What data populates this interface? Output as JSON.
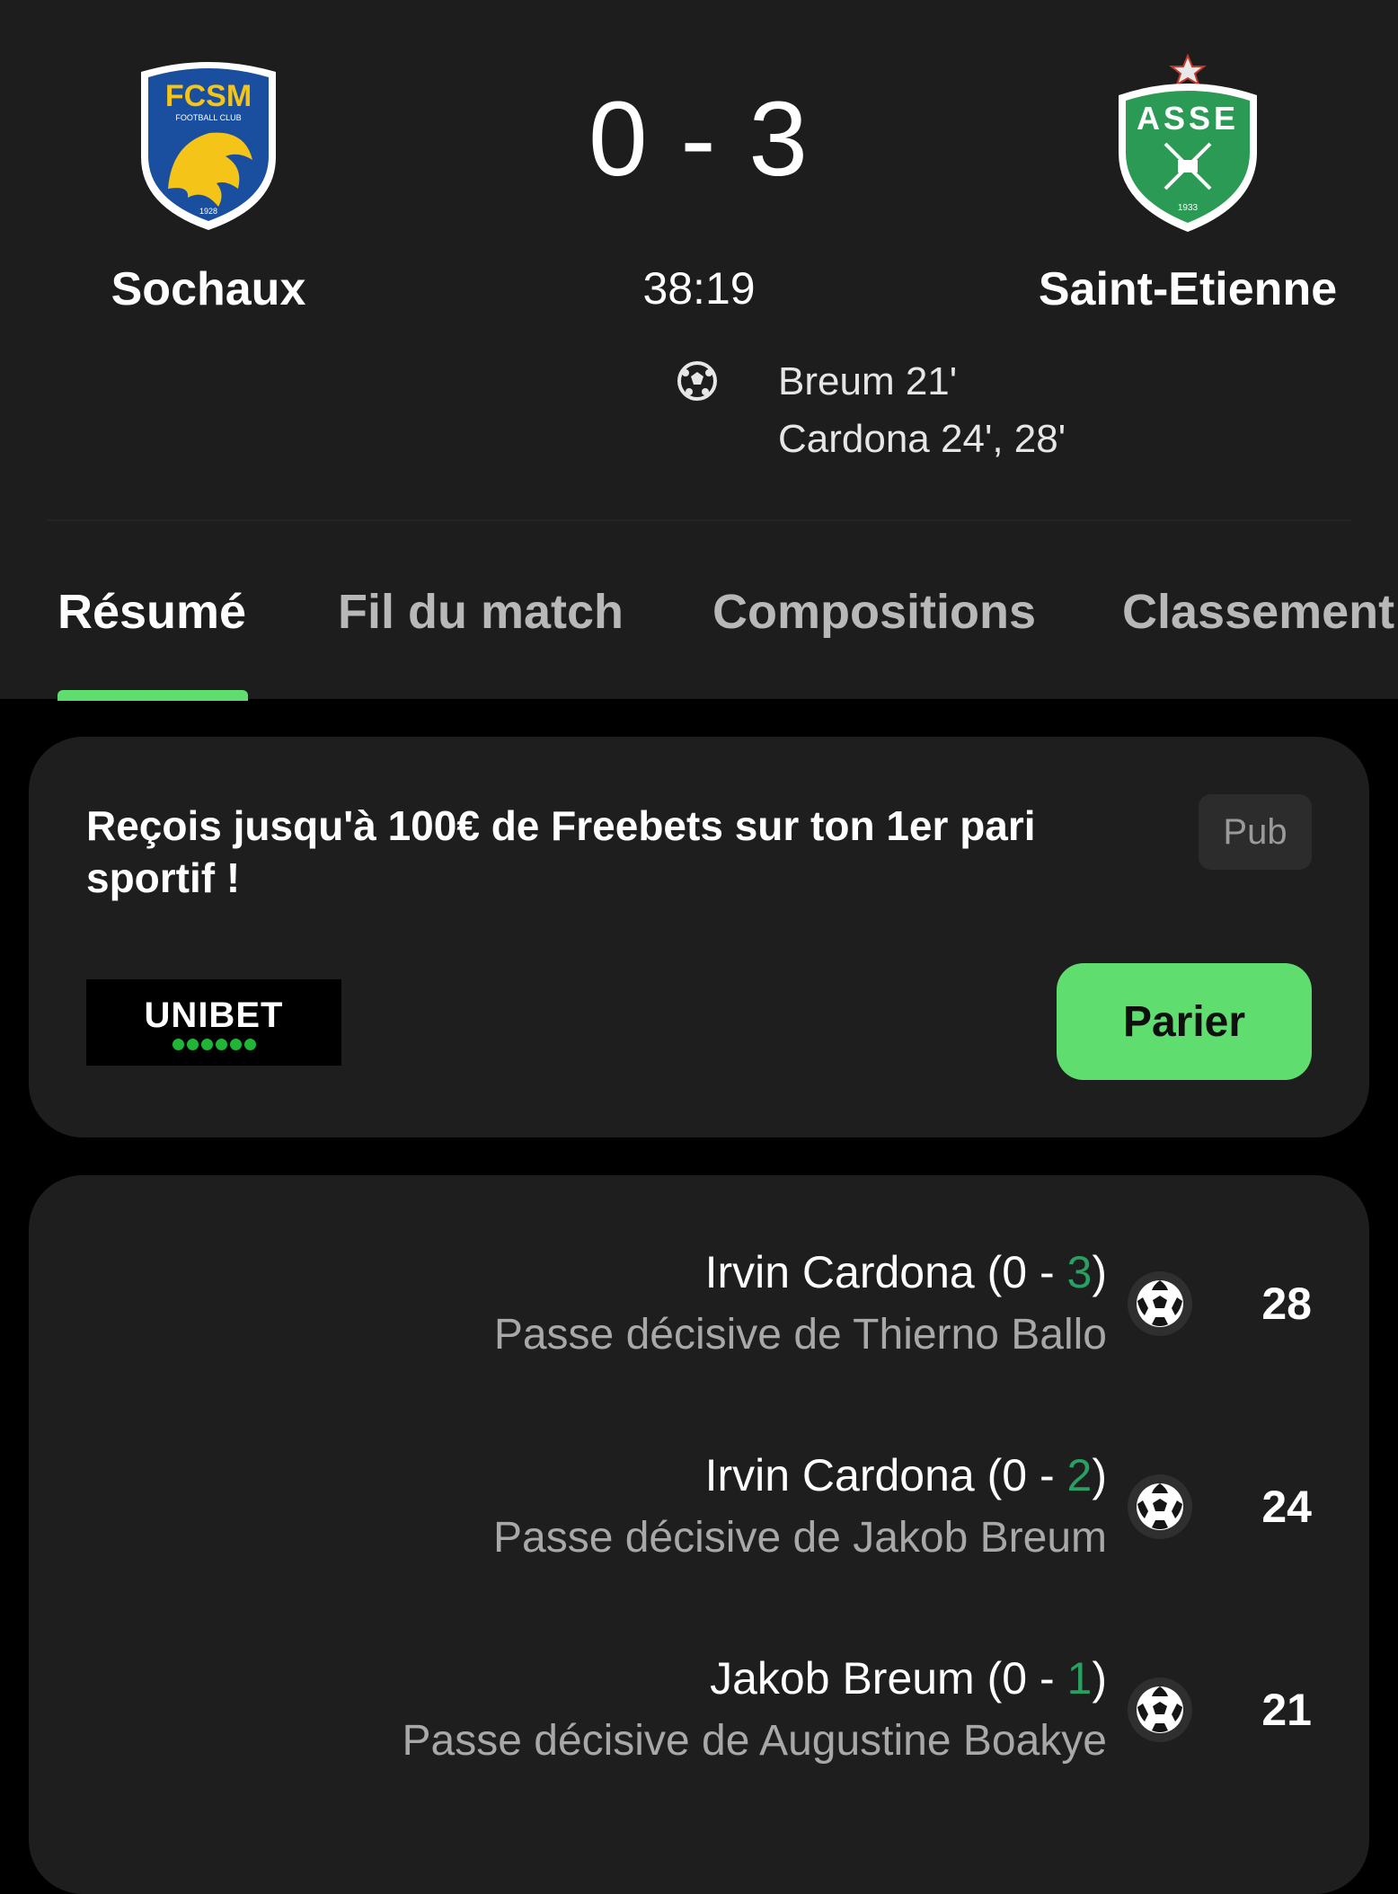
{
  "match": {
    "home_team": {
      "name": "Sochaux",
      "crest_name": "FCSM",
      "crest_sub": "FOOTBALL CLUB",
      "crest_year": "1928",
      "color": "#1a4fa0"
    },
    "away_team": {
      "name": "Saint-Etienne",
      "crest_name": "ASSE",
      "crest_year": "1933",
      "color": "#2a9a55"
    },
    "score": "0 - 3",
    "clock": "38:19",
    "scorers": [
      "Breum 21'",
      "Cardona 24', 28'"
    ]
  },
  "tabs": [
    {
      "label": "Résumé",
      "active": true
    },
    {
      "label": "Fil du match",
      "active": false
    },
    {
      "label": "Compositions",
      "active": false
    },
    {
      "label": "Classement",
      "active": false
    }
  ],
  "ad": {
    "text": "Reçois jusqu'à 100€ de Freebets sur ton 1er pari sportif !",
    "badge": "Pub",
    "brand": "UNIBET",
    "button_label": "Parier"
  },
  "events": [
    {
      "player": "Irvin Cardona",
      "score_prefix": "(0 - ",
      "score_value": "3",
      "score_suffix": ")",
      "assist": "Passe décisive de Thierno Ballo",
      "minute": "28",
      "icon": "soccer-ball-icon"
    },
    {
      "player": "Irvin Cardona",
      "score_prefix": "(0 - ",
      "score_value": "2",
      "score_suffix": ")",
      "assist": "Passe décisive de Jakob Breum",
      "minute": "24",
      "icon": "soccer-ball-icon"
    },
    {
      "player": "Jakob Breum",
      "score_prefix": "(0 - ",
      "score_value": "1",
      "score_suffix": ")",
      "assist": "Passe décisive de Augustine Boakye",
      "minute": "21",
      "icon": "soccer-ball-icon"
    }
  ],
  "colors": {
    "accent": "#5fdd6f",
    "score_highlight": "#29a061",
    "header_bg": "#1d1d1d",
    "card_bg": "#1e1e1e"
  }
}
